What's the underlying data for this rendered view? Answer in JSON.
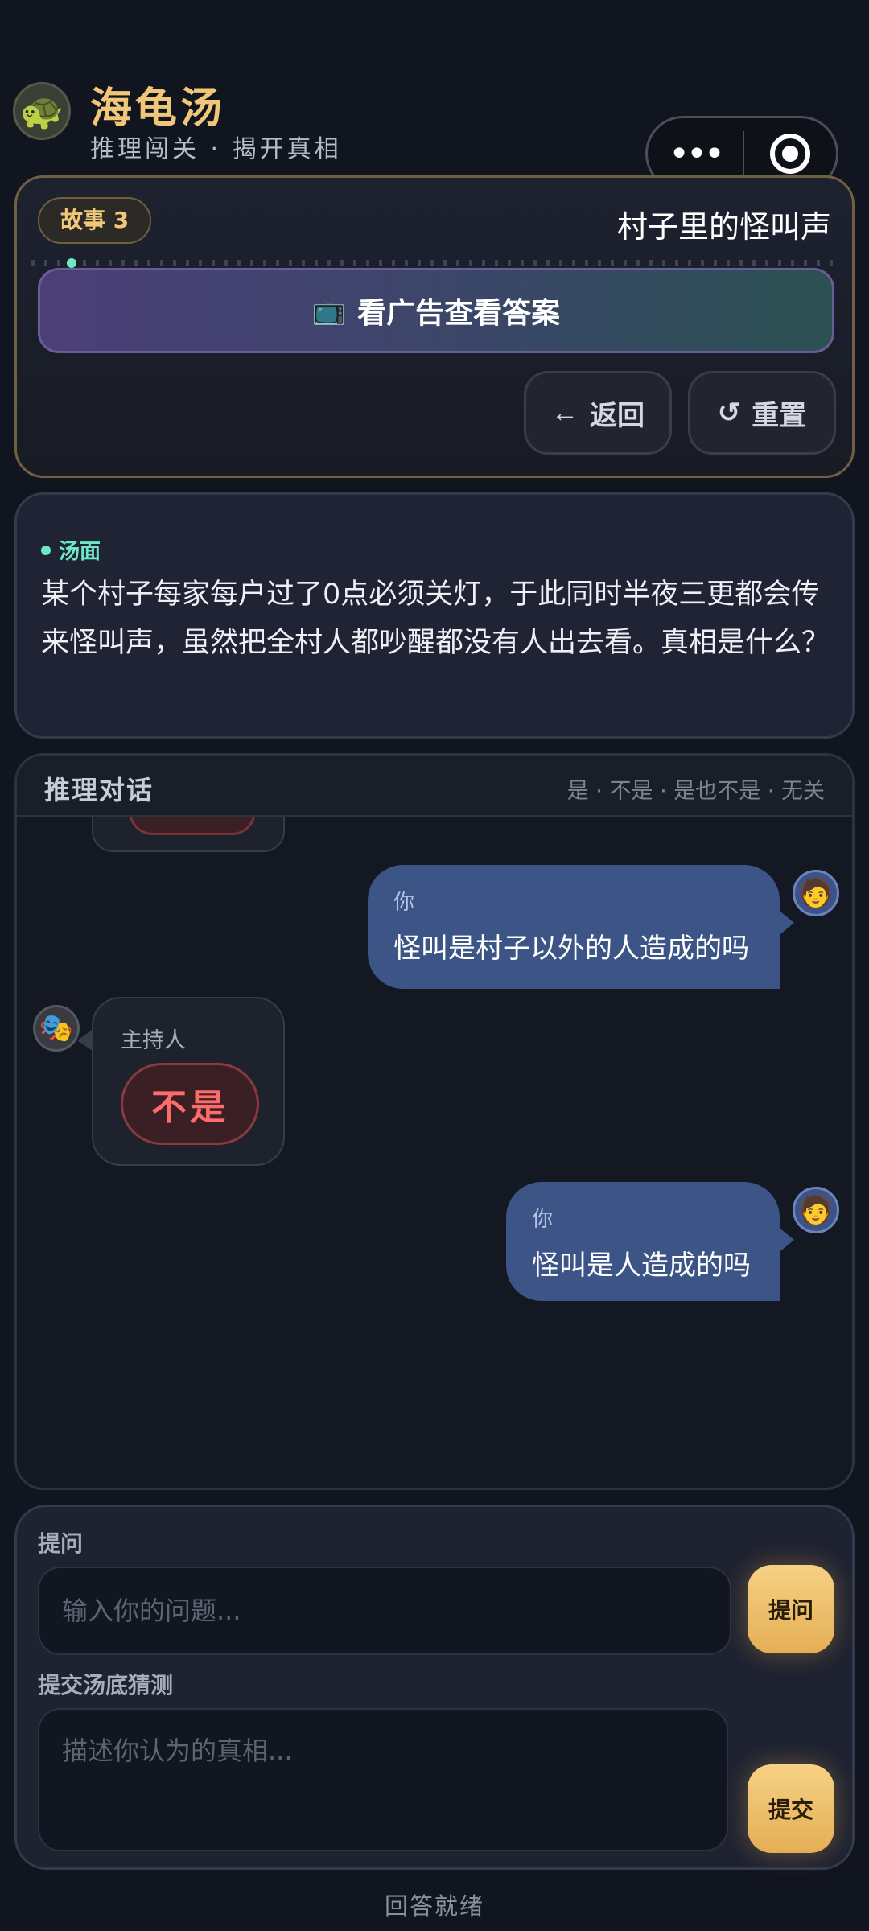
{
  "header": {
    "logo_icon": "turtle-icon",
    "title": "海龟汤",
    "subtitle": "推理闯关 · 揭开真相"
  },
  "capsule": {
    "more_label": "•••",
    "icons": [
      "more-icon",
      "target-icon"
    ]
  },
  "story": {
    "badge": "故事 3",
    "title": "村子里的怪叫声",
    "ad_button": "看广告查看答案",
    "back_button": "返回",
    "reset_button": "重置"
  },
  "soup": {
    "label": "汤面",
    "text": "某个村子每家每户过了0点必须关灯，于此同时半夜三更都会传来怪叫声，虽然把全村人都吵醒都没有人出去看。真相是什么？"
  },
  "chat": {
    "title": "推理对话",
    "hint": "是 · 不是 · 是也不是 · 无关",
    "messages": [
      {
        "role": "user",
        "name": "你",
        "text": "怪叫是村子以外的人造成的吗"
      },
      {
        "role": "host",
        "name": "主持人",
        "answer": "不是"
      },
      {
        "role": "user",
        "name": "你",
        "text": "怪叫是人造成的吗"
      }
    ]
  },
  "input": {
    "ask_label": "提问",
    "ask_placeholder": "输入你的问题...",
    "ask_button": "提问",
    "guess_label": "提交汤底猜测",
    "guess_placeholder": "描述你认为的真相...",
    "submit_button": "提交"
  },
  "status": "回答就绪",
  "colors": {
    "accent_gold": "#f0c778",
    "accent_teal": "#6fe8c6",
    "answer_red": "#ff6b6b",
    "user_bubble": "#3c5486"
  }
}
